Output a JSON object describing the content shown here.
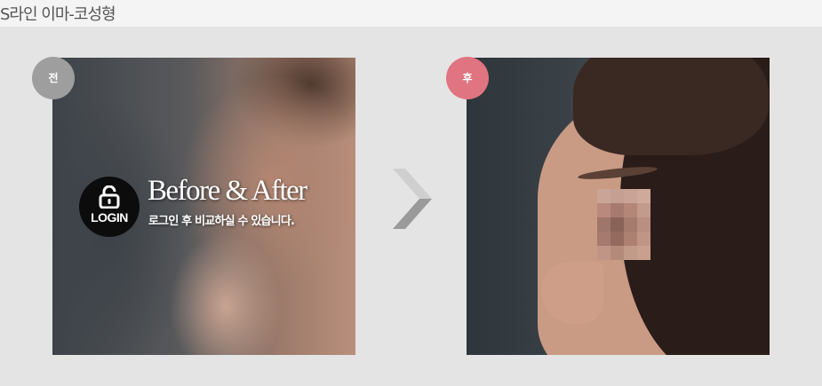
{
  "header": {
    "title": "S라인 이마-코성형"
  },
  "before_panel": {
    "badge_label": "전",
    "overlay": {
      "login_label": "LOGIN",
      "title": "Before & After",
      "subtitle": "로그인 후 비교하실 수 있습니다."
    },
    "icons": [
      "lock-icon"
    ]
  },
  "after_panel": {
    "badge_label": "후"
  },
  "icons": {
    "arrow": "chevron-right-icon",
    "lock": "lock-icon"
  },
  "colors": {
    "background": "#e4e4e4",
    "header_background": "#f4f4f4",
    "before_badge": "#9e9e9e",
    "after_badge": "#e07480",
    "login_circle": "#0c0c0c",
    "arrow": "#a8a8a8"
  }
}
